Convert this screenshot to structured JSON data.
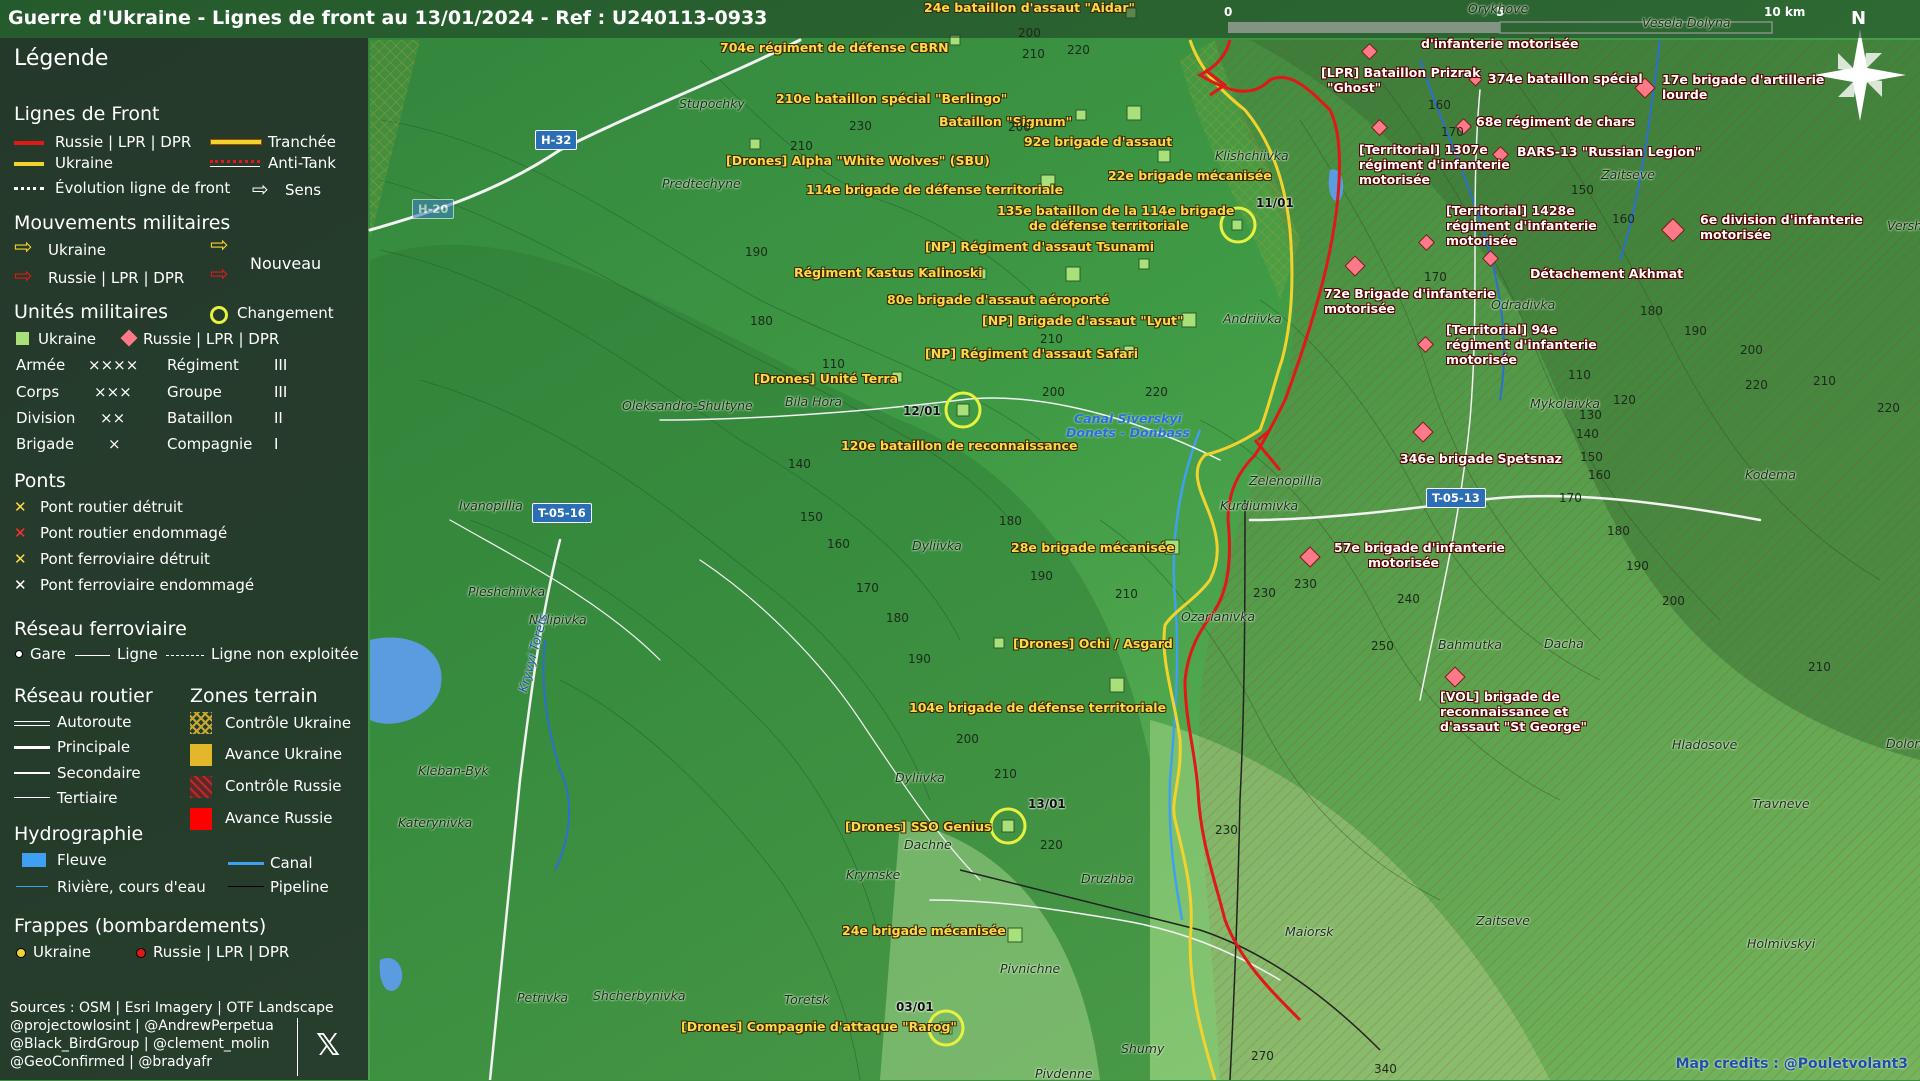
{
  "title": "Guerre d'Ukraine - Lignes de front au 13/01/2024 - Ref : U240113-0933",
  "colors": {
    "russia": "#e01818",
    "ukraine": "#f2d22c",
    "ukraine_unit": "#a8e07a",
    "russia_unit": "#ff7a88",
    "highlight": "#e8f040",
    "water": "#5b9be0"
  },
  "legend": {
    "title": "Légende",
    "front_lines": {
      "heading": "Lignes de Front",
      "russia": "Russie | LPR | DPR",
      "ukraine": "Ukraine",
      "evolution": "Évolution ligne de front",
      "trench": "Tranchée",
      "antitank": "Anti-Tank",
      "direction": "Sens"
    },
    "movements": {
      "heading": "Mouvements militaires",
      "ukraine": "Ukraine",
      "russia": "Russie | LPR | DPR",
      "new": "Nouveau"
    },
    "units": {
      "heading": "Unités militaires",
      "change": "Changement",
      "ukraine": "Ukraine",
      "russia": "Russie | LPR | DPR",
      "echelons": [
        {
          "label": "Armée",
          "symbol": "××××"
        },
        {
          "label": "Corps",
          "symbol": "×××"
        },
        {
          "label": "Division",
          "symbol": "××"
        },
        {
          "label": "Brigade",
          "symbol": "×"
        }
      ],
      "echelons2": [
        {
          "label": "Régiment",
          "symbol": "III"
        },
        {
          "label": "Groupe",
          "symbol": "III"
        },
        {
          "label": "Bataillon",
          "symbol": "II"
        },
        {
          "label": "Compagnie",
          "symbol": "I"
        }
      ]
    },
    "bridges": {
      "heading": "Ponts",
      "items": [
        "Pont routier détruit",
        "Pont routier endommagé",
        "Pont ferroviaire détruit",
        "Pont ferroviaire endommagé"
      ]
    },
    "rail": {
      "heading": "Réseau ferroviaire",
      "station": "Gare",
      "line": "Ligne",
      "unused": "Ligne non exploitée"
    },
    "roads": {
      "heading": "Réseau routier",
      "items": [
        "Autoroute",
        "Principale",
        "Secondaire",
        "Tertiaire"
      ]
    },
    "zones": {
      "heading": "Zones terrain",
      "items": [
        "Contrôle Ukraine",
        "Avance Ukraine",
        "Contrôle Russie",
        "Avance Russie"
      ]
    },
    "hydro": {
      "heading": "Hydrographie",
      "river_big": "Fleuve",
      "canal": "Canal",
      "river": "Rivière, cours d'eau",
      "pipeline": "Pipeline"
    },
    "strikes": {
      "heading": "Frappes (bombardements)",
      "ukraine": "Ukraine",
      "russia": "Russie | LPR | DPR"
    },
    "sources": [
      "Sources : OSM | Esri Imagery | OTF Landscape",
      "@projectowlosint | @AndrewPerpetua",
      "@Black_BirdGroup | @clement_molin",
      "@GeoConfirmed | @bradyafr"
    ]
  },
  "scale": {
    "start": "0",
    "mid": "5",
    "end": "10 km"
  },
  "north": "N",
  "credit": "Map credits : @Pouletvolant3",
  "ukraine_units": [
    "24e bataillon d'assaut \"Aidar\"",
    "704e régiment de défense CBRN",
    "210e bataillon spécial \"Berlingo\"",
    "Bataillon \"Signum\"",
    "[Drones] Alpha \"White Wolves\" (SBU)",
    "92e brigade d'assaut",
    "22e brigade mécanisée",
    "114e brigade de défense territoriale",
    "135e bataillon de la 114e brigade",
    "de défense territoriale",
    "[NP] Régiment d'assaut Tsunami",
    "Régiment Kastus Kalinoski",
    "80e brigade d'assaut aéroporté",
    "[NP] Brigade d'assaut \"Lyut\"",
    "[NP] Régiment d'assaut Safari",
    "[Drones] Unité Terra",
    "120e bataillon de reconnaissance",
    "28e brigade mécanisée",
    "[Drones] Ochi / Asgard",
    "104e brigade de défense territoriale",
    "[Drones] SSO Genius",
    "24e brigade mécanisée",
    "[Drones] Compagnie d'attaque \"Rarog\""
  ],
  "russia_units": [
    "d'infanterie motorisée",
    "[LPR] Bataillon Prizrak",
    "\"Ghost\"",
    "374e bataillon spécial",
    "17e brigade d'artillerie",
    "lourde",
    "68e régiment de chars",
    "[Territorial] 1307e",
    "régiment d'infanterie",
    "motorisée",
    "BARS-13 \"Russian Legion\"",
    "[Territorial] 1428e",
    "régiment d'infanterie",
    "motorisée",
    "6e division d'infanterie",
    "motorisée",
    "Détachement Akhmat",
    "72e Brigade d'infanterie",
    "motorisée",
    "[Territorial] 94e",
    "régiment d'infanterie",
    "motorisée",
    "346e brigade Spetsnaz",
    "57e brigade d'infanterie",
    "motorisée",
    "[VOL] brigade de",
    "reconnaissance et",
    "d'assaut \"St George\""
  ],
  "dates": [
    "11/01",
    "12/01",
    "13/01",
    "03/01"
  ],
  "towns": [
    "Vesela Dolyna",
    "Orykhove",
    "Stupochky",
    "Predtechyne",
    "Klishchiivka",
    "Zaitseve",
    "Versh",
    "Odradivka",
    "Andriivka",
    "Oleksandro-Shultyne",
    "Bila Hora",
    "Mykolaivka",
    "Zelenopillia",
    "Kurdiumivka",
    "Kodema",
    "Ivanopillia",
    "Pleshchiivka",
    "Nelipivka",
    "Dyliivka",
    "Ozarianivka",
    "Bahmutka",
    "Dacha",
    "Hladosove",
    "Dolon",
    "Kleban-Byk",
    "Katerynivka",
    "Dyliivka",
    "Travneve",
    "Dachne",
    "Krymske",
    "Druzhba",
    "Zaitseve",
    "Holmivskyi",
    "Maiorsk",
    "Pivnichne",
    "Petrivka",
    "Shcherbynivka",
    "Toretsk",
    "Shumy",
    "Pivdenne",
    "Kryvyi Torets"
  ],
  "roads_labels": [
    "H-32",
    "H-20",
    "T-05-16",
    "T-05-13"
  ],
  "canal_label": [
    "Canal Siverskyi",
    "Donets - Donbass"
  ],
  "elevations": [
    "200",
    "210",
    "220",
    "160",
    "170",
    "230",
    "210",
    "200",
    "190",
    "180",
    "150",
    "160",
    "170",
    "180",
    "200",
    "210",
    "220",
    "190",
    "110",
    "120",
    "130",
    "140",
    "150",
    "160",
    "170",
    "180",
    "190",
    "200",
    "210",
    "220",
    "230",
    "240",
    "250",
    "140",
    "150",
    "160",
    "170",
    "180",
    "190",
    "200",
    "210",
    "220",
    "230",
    "270",
    "340",
    "110",
    "200",
    "220",
    "180",
    "190",
    "210",
    "230",
    "210"
  ]
}
